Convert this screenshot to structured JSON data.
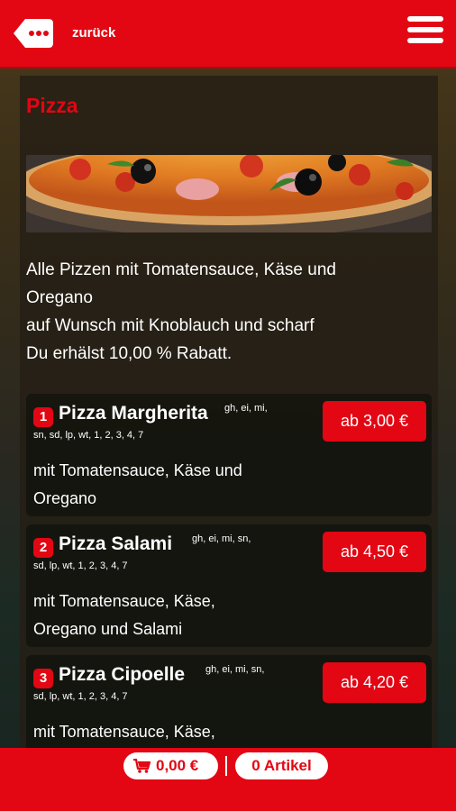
{
  "header": {
    "back_label": "zurück",
    "back_icon": "ellipsis-tag-icon",
    "menu_icon": "hamburger-menu-icon"
  },
  "category": {
    "title": "Pizza",
    "intro_lines": [
      "Alle Pizzen mit Tomatensauce, Käse und",
      "Oregano",
      "auf Wunsch mit Knoblauch und scharf",
      "Du erhälst 10,00 % Rabatt."
    ]
  },
  "products": [
    {
      "number": "1",
      "name": "Pizza Margherita",
      "allergens_line1": "gh, ei, mi,",
      "allergens_line2": "sn, sd, lp, wt, 1, 2, 3, 4, 7",
      "price": "ab 3,00 €",
      "desc_lines": [
        "mit Tomatensauce, Käse und",
        "Oregano"
      ]
    },
    {
      "number": "2",
      "name": "Pizza Salami",
      "allergens_line1": "gh, ei, mi, sn,",
      "allergens_line2": "sd, lp, wt, 1, 2, 3, 4, 7",
      "price": "ab 4,50 €",
      "desc_lines": [
        "mit Tomatensauce, Käse,",
        "Oregano und Salami"
      ]
    },
    {
      "number": "3",
      "name": "Pizza Cipoelle",
      "allergens_line1": "gh, ei, mi, sn,",
      "allergens_line2": "sd, lp, wt, 1, 2, 3, 4, 7",
      "price": "ab 4,20 €",
      "desc_lines": [
        "mit Tomatensauce, Käse,",
        ""
      ]
    }
  ],
  "cart": {
    "total": "0,00 €",
    "count": "0 Artikel",
    "cart_icon": "shopping-cart-icon"
  },
  "colors": {
    "brand_red": "#e30613"
  }
}
